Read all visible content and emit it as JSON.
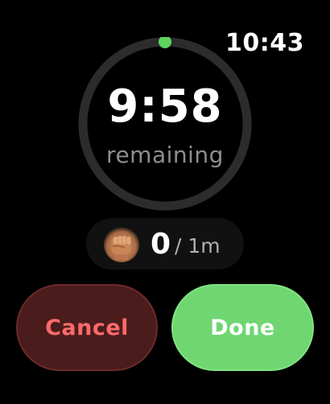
{
  "status_bar": {
    "time": "10:43"
  },
  "timer": {
    "countdown": "9:58",
    "remaining_label": "remaining",
    "progress_fraction": 0.997,
    "ring_track_color": "#2c2c2e",
    "ring_progress_color": "#5ed35e"
  },
  "activity": {
    "icon": "fist-emoji-icon",
    "count": "0",
    "goal": "/ 1m"
  },
  "actions": {
    "cancel_label": "Cancel",
    "done_label": "Done",
    "cancel_color": "#ff6a6a",
    "done_color": "#6fd672"
  }
}
